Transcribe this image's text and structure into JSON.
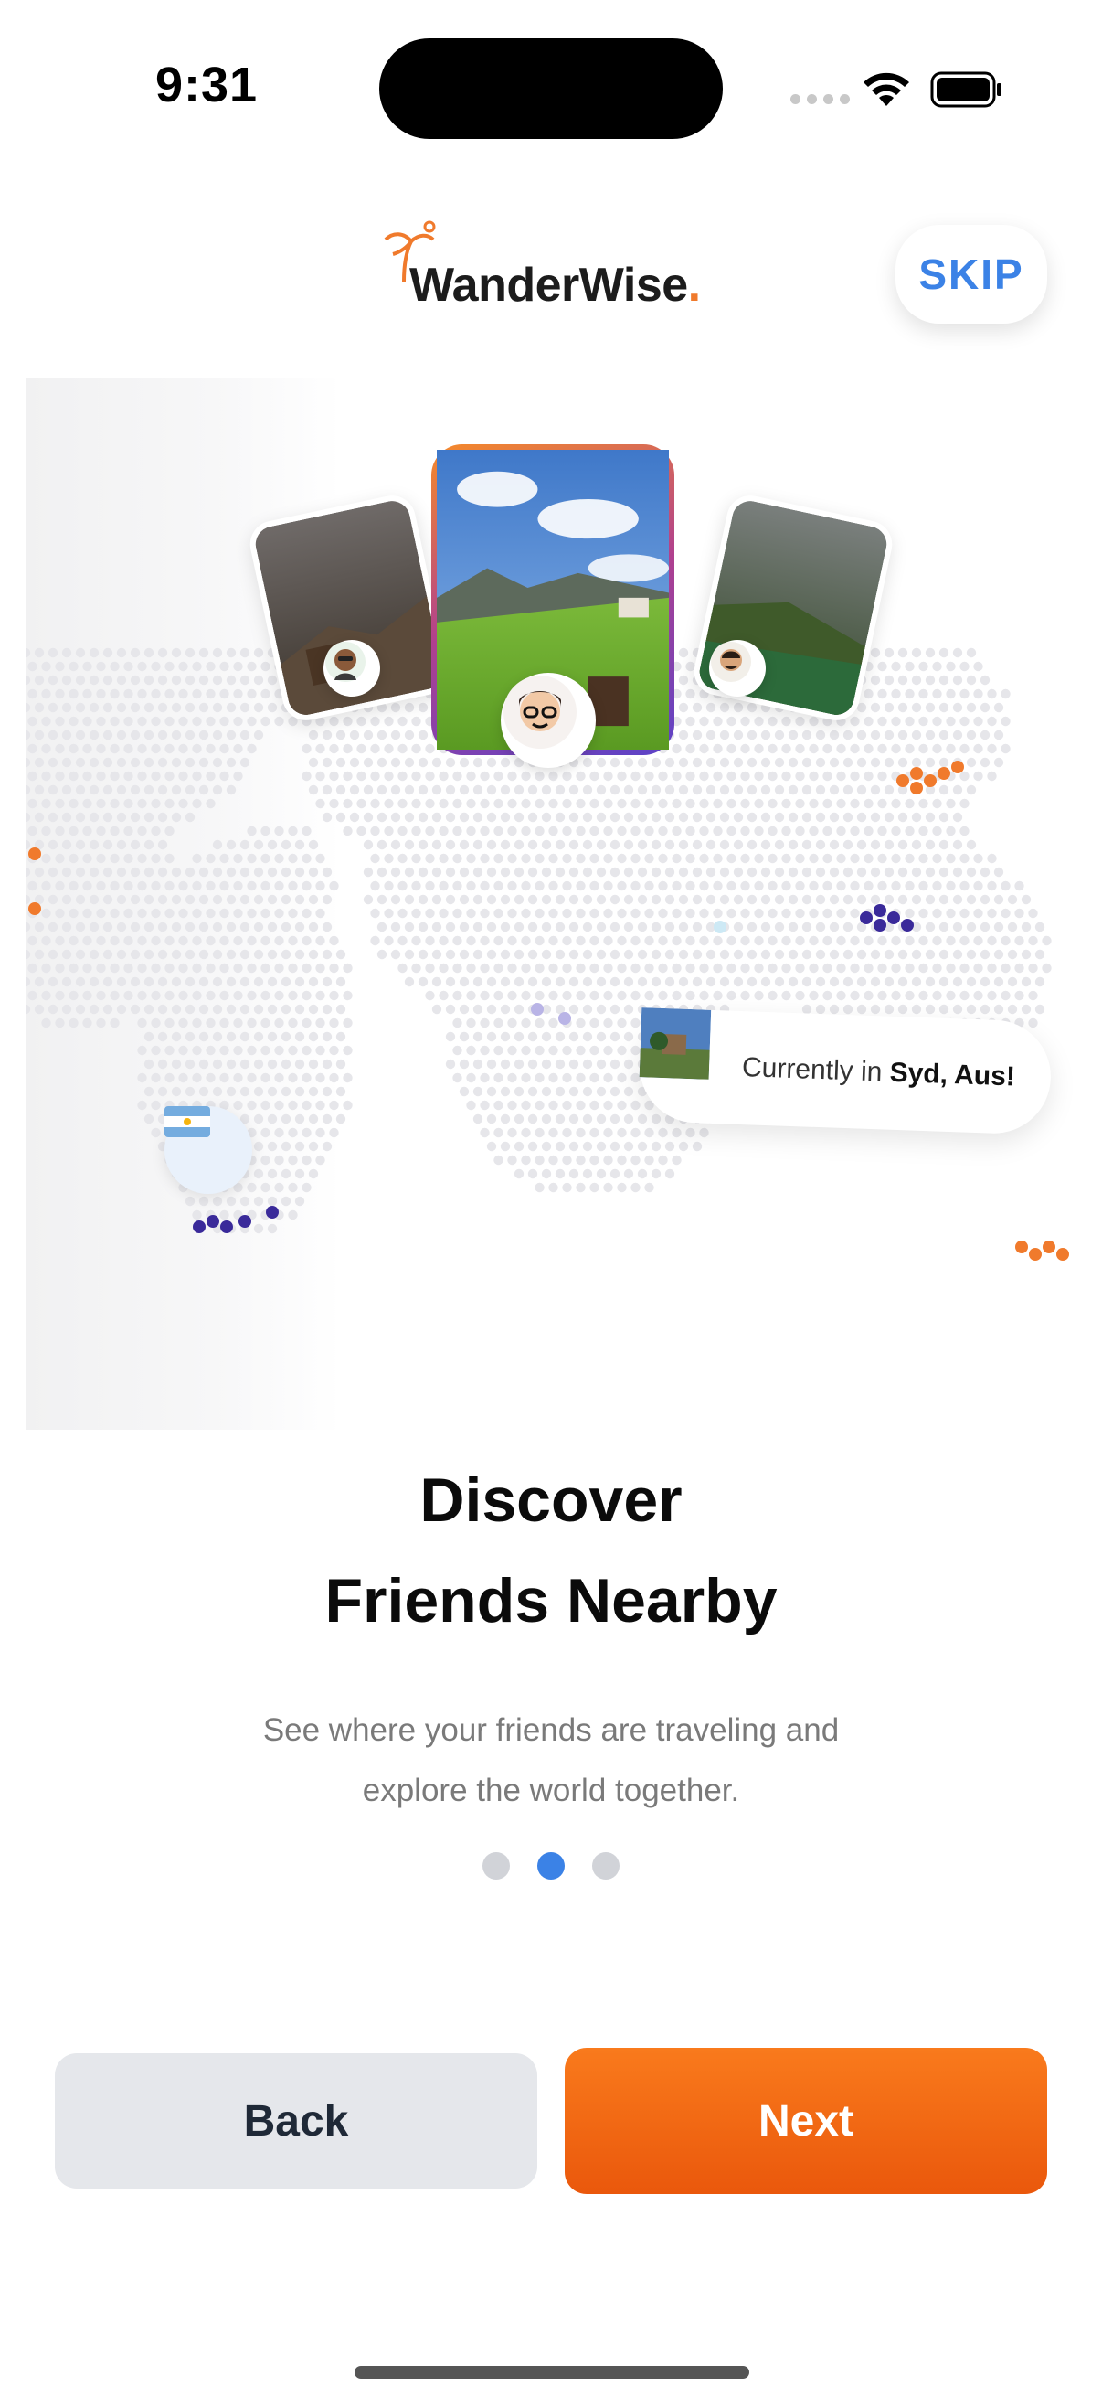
{
  "status_bar": {
    "time": "9:31"
  },
  "header": {
    "logo_text": "WanderWise",
    "logo_dot": ".",
    "skip_label": "SKIP"
  },
  "hero": {
    "location_pill": {
      "prefix": "Currently in ",
      "place": "Syd, Aus!"
    },
    "flag": "🇦🇷"
  },
  "content": {
    "title_line1": "Discover",
    "title_line2": "Friends Nearby",
    "subtitle_line1": "See where your friends are traveling and",
    "subtitle_line2": "explore the world together."
  },
  "pagination": {
    "total": 3,
    "active_index": 1
  },
  "buttons": {
    "back_label": "Back",
    "next_label": "Next"
  },
  "colors": {
    "accent": "#3b82e6",
    "brand_orange": "#f07a2c",
    "next_button": "#ea580c",
    "back_button": "#e5e7eb"
  }
}
